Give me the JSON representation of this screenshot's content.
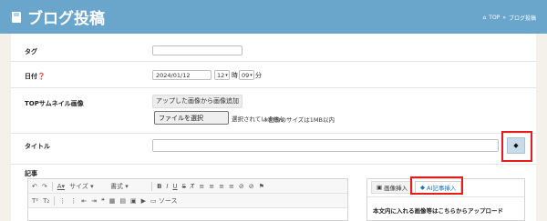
{
  "header": {
    "title": "ブログ投稿",
    "breadcrumb": {
      "home": "TOP",
      "separator": "»",
      "current": "ブログ投稿"
    }
  },
  "form": {
    "tag": {
      "label": "タグ",
      "value": ""
    },
    "date": {
      "label": "日付",
      "value": "2024/01/12",
      "hour": "12",
      "hour_unit": "時",
      "minute": "09",
      "minute_unit": "分"
    },
    "thumbnail": {
      "label": "TOPサムネイル画像",
      "add_from_uploaded": "アップした画像から画像追加",
      "file_button": "ファイルを選択",
      "file_status": "選択されていません",
      "size_note": "※画像のサイズは1MB以内"
    },
    "title": {
      "label": "タイトル",
      "value": "",
      "ai_button": "◆"
    },
    "article": {
      "label": "記事"
    }
  },
  "editor": {
    "toolbar_row1": [
      "↶",
      "↷",
      "A",
      "サイズ",
      "書式",
      "B",
      "I",
      "U",
      "S",
      "T",
      "≡",
      "≡",
      "≡",
      "≡",
      "⊘",
      "⊘",
      "⚑"
    ],
    "size_label": "サイズ",
    "format_label": "書式",
    "source_label": "ソース"
  },
  "side_panel": {
    "tabs": [
      {
        "label": "画像挿入",
        "active": false
      },
      {
        "label": "AI記事挿入",
        "active": true
      }
    ],
    "upload_text": "本文内に入れる画像等はこちらからアップロード"
  },
  "colors": {
    "header_bg": "#6aa6cc",
    "highlight": "#e51c1c",
    "ai_button_bg": "#c9dbe9"
  }
}
